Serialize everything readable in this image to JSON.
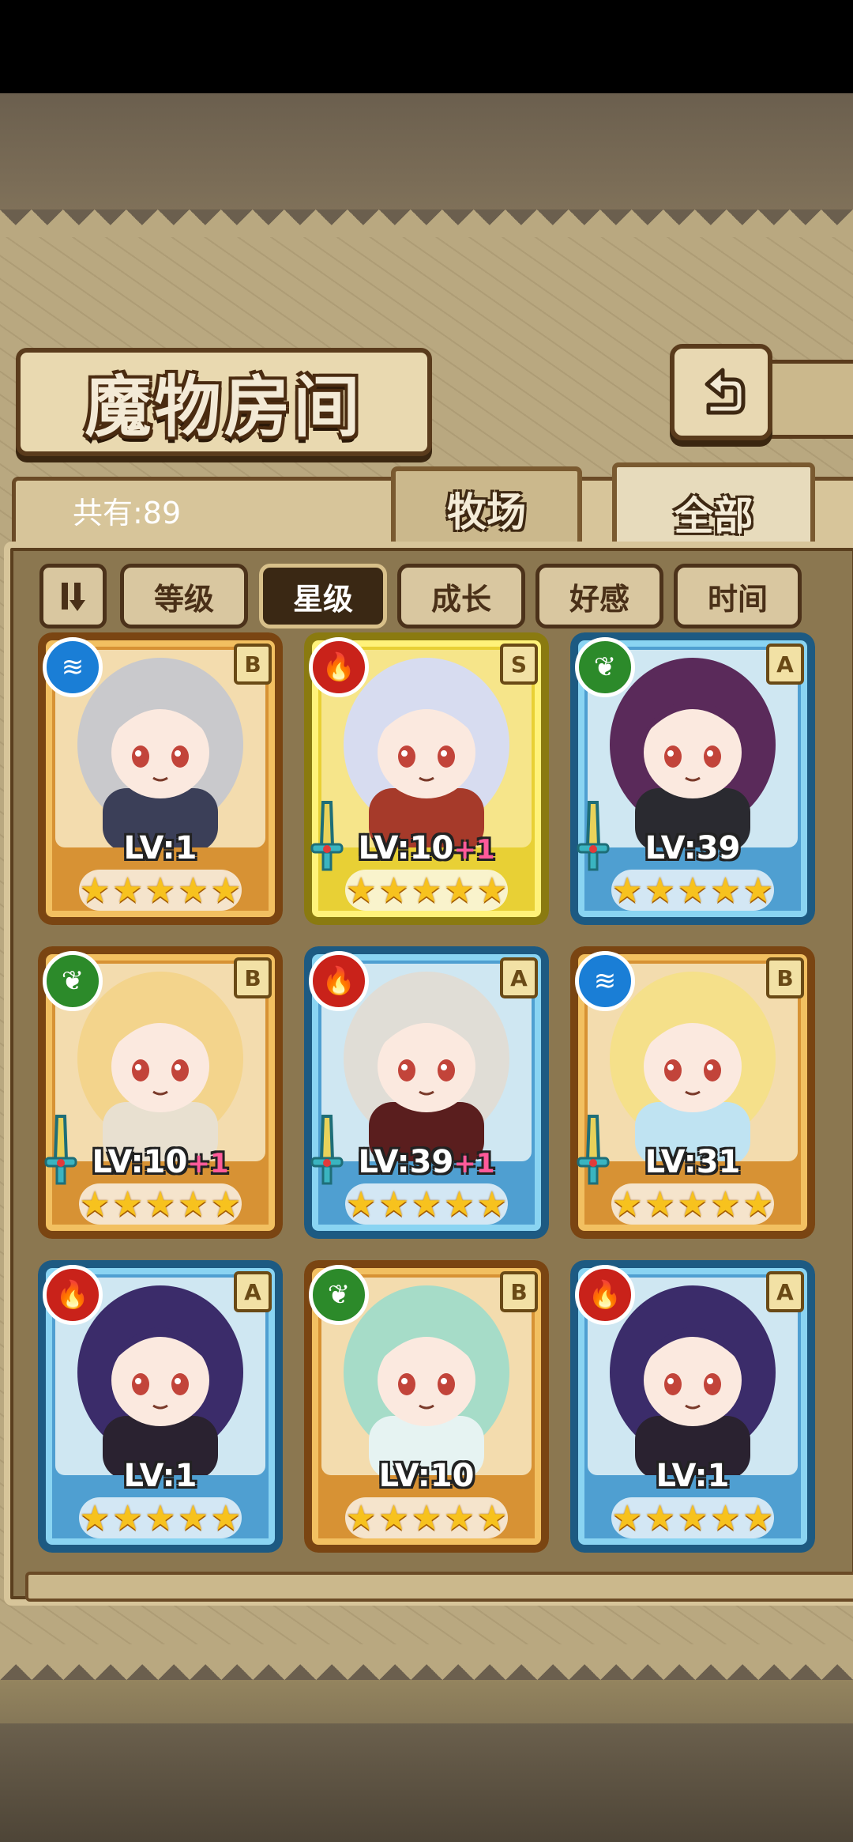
{
  "header": {
    "title": "魔物房间",
    "back_icon": "return-arrow-icon"
  },
  "collection": {
    "count_label": "共有:89"
  },
  "tabs": [
    {
      "label": "牧场",
      "active": false
    },
    {
      "label": "全部",
      "active": true
    }
  ],
  "sort": {
    "toggle_icon": "sort-order-icon",
    "buttons": [
      {
        "label": "等级",
        "active": false
      },
      {
        "label": "星级",
        "active": true
      },
      {
        "label": "成长",
        "active": false
      },
      {
        "label": "好感",
        "active": false
      },
      {
        "label": "时间",
        "active": false
      }
    ]
  },
  "monsters": [
    {
      "element": "water",
      "element_icon": "water-element-icon",
      "rank": "B",
      "level": "LV:1",
      "bonus": "",
      "stars": 5,
      "frame": "gold",
      "weapon": false,
      "hair": "#c9c9cc",
      "outfit": "#3b3f58"
    },
    {
      "element": "fire",
      "element_icon": "fire-element-icon",
      "rank": "S",
      "level": "LV:10",
      "bonus": "+1",
      "stars": 5,
      "frame": "legend",
      "weapon": true,
      "hair": "#d7dcf0",
      "outfit": "#a63a2a"
    },
    {
      "element": "wood",
      "element_icon": "leaf-element-icon",
      "rank": "A",
      "level": "LV:39",
      "bonus": "",
      "stars": 5,
      "frame": "blue",
      "weapon": true,
      "hair": "#5a2a5a",
      "outfit": "#2a2a30"
    },
    {
      "element": "wood",
      "element_icon": "leaf-element-icon",
      "rank": "B",
      "level": "LV:10",
      "bonus": "+1",
      "stars": 5,
      "frame": "gold",
      "weapon": true,
      "hair": "#f3d48c",
      "outfit": "#e8e0d0"
    },
    {
      "element": "fire",
      "element_icon": "fire-element-icon",
      "rank": "A",
      "level": "LV:39",
      "bonus": "+1",
      "stars": 5,
      "frame": "blue",
      "weapon": true,
      "hair": "#e0ddd6",
      "outfit": "#5a1e1e"
    },
    {
      "element": "water",
      "element_icon": "water-element-icon",
      "rank": "B",
      "level": "LV:31",
      "bonus": "",
      "stars": 5,
      "frame": "gold",
      "weapon": true,
      "hair": "#f5e08a",
      "outfit": "#bfe3f2"
    },
    {
      "element": "fire",
      "element_icon": "fire-element-icon",
      "rank": "A",
      "level": "LV:1",
      "bonus": "",
      "stars": 5,
      "frame": "blue",
      "weapon": false,
      "hair": "#3b2c6a",
      "outfit": "#2a2230"
    },
    {
      "element": "wood",
      "element_icon": "leaf-element-icon",
      "rank": "B",
      "level": "LV:10",
      "bonus": "",
      "stars": 5,
      "frame": "gold",
      "weapon": false,
      "hair": "#a6dcc8",
      "outfit": "#e6f3f2"
    },
    {
      "element": "fire",
      "element_icon": "fire-element-icon",
      "rank": "A",
      "level": "LV:1",
      "bonus": "",
      "stars": 5,
      "frame": "blue",
      "weapon": false,
      "hair": "#3b2c6a",
      "outfit": "#2a2230"
    }
  ]
}
